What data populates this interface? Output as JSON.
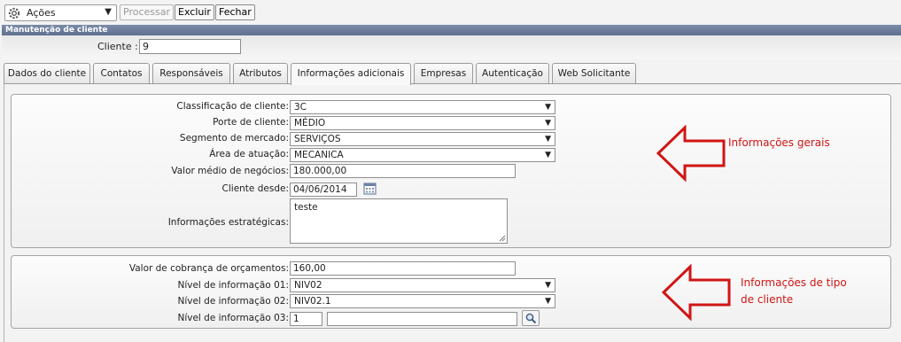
{
  "toolbar": {
    "acoes_label": "Ações",
    "processar_label": "Processar",
    "excluir_label": "Excluir",
    "fechar_label": "Fechar"
  },
  "section_title": "Manutenção de cliente",
  "client": {
    "label": "Cliente :",
    "value": "9"
  },
  "tabs": [
    {
      "label": "Dados do cliente"
    },
    {
      "label": "Contatos"
    },
    {
      "label": "Responsáveis"
    },
    {
      "label": "Atributos"
    },
    {
      "label": "Informações adicionais"
    },
    {
      "label": "Empresas"
    },
    {
      "label": "Autenticação"
    },
    {
      "label": "Web Solicitante"
    }
  ],
  "general": {
    "classificacao_label": "Classificação de cliente:",
    "classificacao_value": "3C",
    "porte_label": "Porte de cliente:",
    "porte_value": "MÉDIO",
    "segmento_label": "Segmento de mercado:",
    "segmento_value": "SERVIÇOS",
    "area_label": "Área de atuação:",
    "area_value": "MECANICA",
    "valor_medio_label": "Valor médio de negócios:",
    "valor_medio_value": "180.000,00",
    "cliente_desde_label": "Cliente desde:",
    "cliente_desde_value": "04/06/2014",
    "info_estrategicas_label": "Informações estratégicas:",
    "info_estrategicas_value": "teste"
  },
  "tipo": {
    "valor_cobranca_label": "Valor de cobrança de orçamentos:",
    "valor_cobranca_value": "160,00",
    "nivel1_label": "Nível de informação 01:",
    "nivel1_value": "NIV02",
    "nivel2_label": "Nível de informação 02:",
    "nivel2_value": "NIV02.1",
    "nivel3_label": "Nível de informação 03:",
    "nivel3_code": "1",
    "nivel3_desc": ""
  },
  "annotations": {
    "gerais": "Informações gerais",
    "tipo_line1": "Informações de tipo",
    "tipo_line2": "de cliente",
    "color": "#d01515"
  },
  "icons": {
    "gear": "gear-icon",
    "dropdown": "chevron-down-icon",
    "calendar": "calendar-icon",
    "search": "search-icon"
  }
}
